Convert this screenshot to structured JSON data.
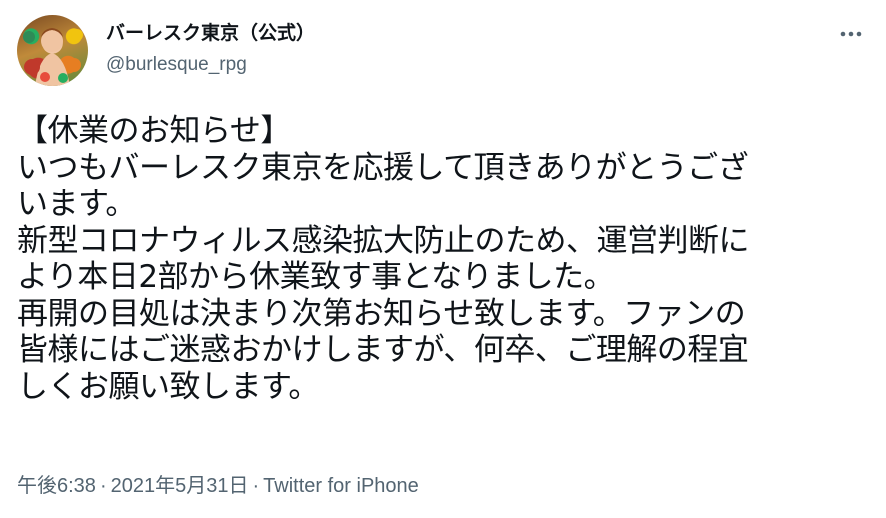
{
  "author": {
    "display_name": "バーレスク東京（公式）",
    "handle": "@burlesque_rpg"
  },
  "more_icon": "more-horizontal-icon",
  "body": {
    "lines": [
      "【休業のお知らせ】",
      "いつもバーレスク東京を応援して頂きありがとうござ",
      "います。",
      "新型コロナウィルス感染拡大防止のため、運営判断に",
      "より本日2部から休業致す事となりました。",
      "再開の目処は決まり次第お知らせ致します。ファンの",
      "皆様にはご迷惑おかけしますが、何卒、ご理解の程宜",
      "しくお願い致します。"
    ]
  },
  "meta": {
    "time": "午後6:38",
    "separator": "·",
    "date": "2021年5月31日",
    "source": "Twitter for iPhone"
  },
  "colors": {
    "text": "#0f1419",
    "secondary": "#536471",
    "background": "#ffffff"
  }
}
